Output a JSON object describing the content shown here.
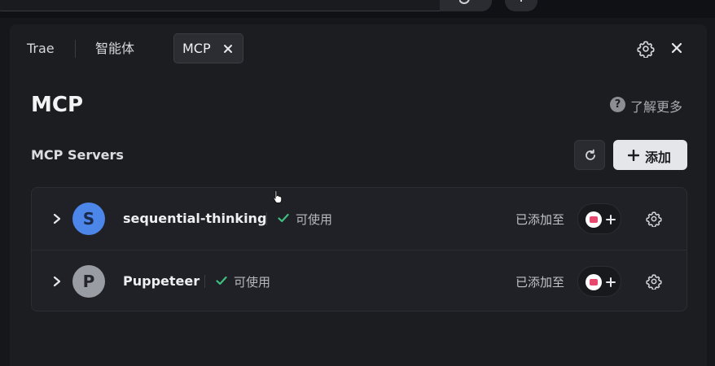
{
  "tabs": {
    "trae": "Trae",
    "agent": "智能体",
    "mcp": "MCP"
  },
  "page": {
    "title": "MCP",
    "learn_more": "了解更多",
    "section_title": "MCP Servers",
    "add_label": "添加"
  },
  "servers": [
    {
      "initial": "S",
      "name": "sequential-thinking",
      "status": "可使用",
      "added_label": "已添加至",
      "avatar_color": "#4b86e8",
      "avatar_text_color": "#1b2a4a"
    },
    {
      "initial": "P",
      "name": "Puppeteer",
      "status": "可使用",
      "added_label": "已添加至",
      "avatar_color": "#9a9ca3",
      "avatar_text_color": "#25262b"
    }
  ],
  "colors": {
    "background": "#16171b",
    "panel": "#1c1d21",
    "status_ok": "#3fbf7f",
    "primary_button": "#e4e6ea",
    "client_logo_accent": "#e8476e"
  },
  "icons": [
    "search-icon",
    "plus-icon",
    "close-icon",
    "gear-icon",
    "help-icon",
    "refresh-icon",
    "chevron-right-icon",
    "check-icon",
    "client-logo-icon",
    "cursor-icon"
  ]
}
